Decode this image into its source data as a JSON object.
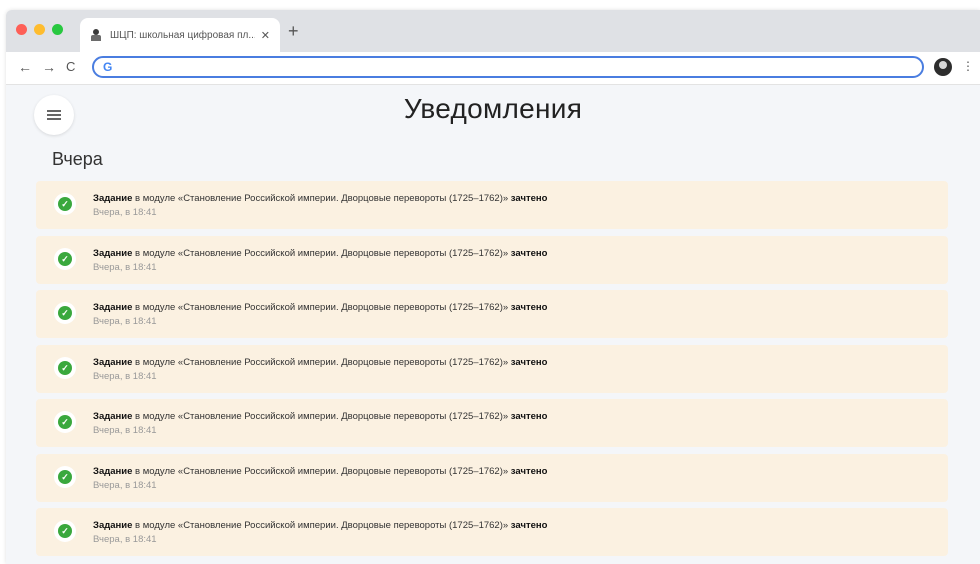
{
  "browser": {
    "tab_title": "ШЦП: школьная цифровая пл...",
    "tab_close": "✕",
    "new_tab": "+",
    "back": "←",
    "forward": "→",
    "reload": "C",
    "omnibox_icon": "G",
    "menu": "⋮"
  },
  "page": {
    "title": "Уведомления",
    "section": "Вчера"
  },
  "notifications": [
    {
      "prefix": "Задание",
      "middle": " в модуле «Становление Российской империи. Дворцовые перевороты (1725–1762)» ",
      "status": "зачтено",
      "time": "Вчера, в 18:41"
    },
    {
      "prefix": "Задание",
      "middle": " в модуле «Становление Российской империи. Дворцовые перевороты (1725–1762)» ",
      "status": "зачтено",
      "time": "Вчера, в 18:41"
    },
    {
      "prefix": "Задание",
      "middle": " в модуле «Становление Российской империи. Дворцовые перевороты (1725–1762)» ",
      "status": "зачтено",
      "time": "Вчера, в 18:41"
    },
    {
      "prefix": "Задание",
      "middle": " в модуле «Становление Российской империи. Дворцовые перевороты (1725–1762)» ",
      "status": "зачтено",
      "time": "Вчера, в 18:41"
    },
    {
      "prefix": "Задание",
      "middle": " в модуле «Становление Российской империи. Дворцовые перевороты (1725–1762)» ",
      "status": "зачтено",
      "time": "Вчера, в 18:41"
    },
    {
      "prefix": "Задание",
      "middle": " в модуле «Становление Российской империи. Дворцовые перевороты (1725–1762)» ",
      "status": "зачтено",
      "time": "Вчера, в 18:41"
    },
    {
      "prefix": "Задание",
      "middle": " в модуле «Становление Российской империи. Дворцовые перевороты (1725–1762)» ",
      "status": "зачтено",
      "time": "Вчера, в 18:41"
    }
  ],
  "icons": {
    "check": "check-icon",
    "hamburger": "hamburger-icon"
  },
  "colors": {
    "item_bg": "#fbf1e1",
    "check_green": "#3aa83d",
    "omnibox_focus": "#4a7de0"
  }
}
